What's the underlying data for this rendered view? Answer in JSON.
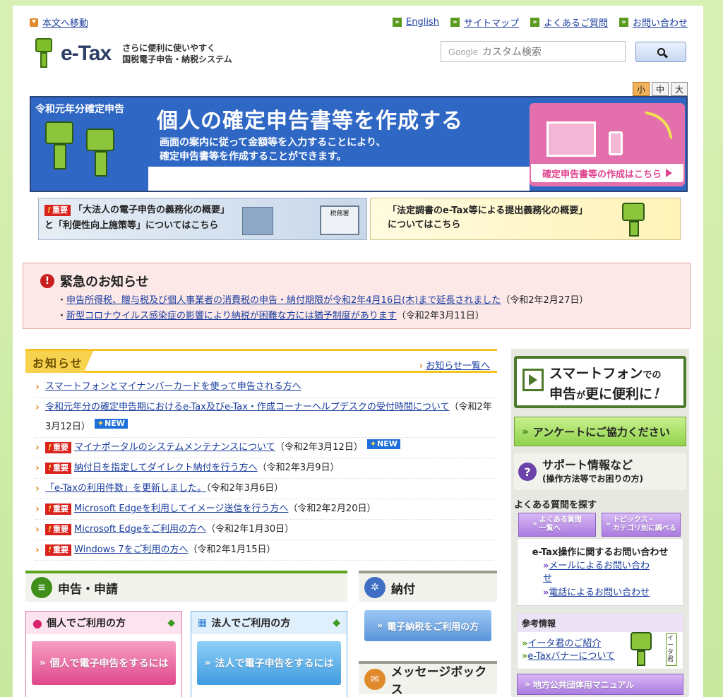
{
  "header": {
    "skip_link": "本文へ移動",
    "top_links": [
      "English",
      "サイトマップ",
      "よくあるご質問",
      "お問い合わせ"
    ],
    "logo_text": "e-Tax",
    "tagline_1": "さらに便利に使いやすく",
    "tagline_2": "国税電子申告・納税システム",
    "search_placeholder": "カスタム検索",
    "search_brand": "Google",
    "font_sizes": [
      "小",
      "中",
      "大"
    ]
  },
  "banner": {
    "year": "令和元年分確定申告",
    "title": "個人の確定申告書等を作成する",
    "sub_1": "画面の案内に従って金額等を入力することにより、",
    "sub_2": "確定申告書等を作成することができます。",
    "cta": "確定申告書等の作成はこちら"
  },
  "sub_banners": {
    "left_badge": "重要",
    "left_1": "「大法人の電子申告の義務化の概要」",
    "left_2": "と「利便性向上施策等」についてはこちら",
    "left_sign": "税務署",
    "right_1": "「法定調書のe-Tax等による提出義務化の概要」",
    "right_2": "についてはこちら"
  },
  "urgent": {
    "title": "緊急のお知らせ",
    "items": [
      {
        "link": "申告所得税、贈与税及び個人事業者の消費税の申告・納付期限が令和2年4月16日(木)まで延長されました",
        "date": "（令和2年2月27日）"
      },
      {
        "link": "新型コロナウイルス感染症の影響により納税が困難な方には猶予制度があります",
        "date": "（令和2年3月11日）"
      }
    ]
  },
  "news": {
    "title": "お知らせ",
    "all_link": "お知らせ一覧へ",
    "badge_important": "重要",
    "badge_new": "NEW",
    "items": [
      {
        "link": "スマートフォンとマイナンバーカードを使って申告される方へ",
        "date": ""
      },
      {
        "link": "令和元年分の確定申告期におけるe-Tax及びe-Tax・作成コーナーヘルプデスクの受付時間について",
        "date": "（令和2年3月12日）"
      },
      {
        "link": "マイナポータルのシステムメンテナンスについて",
        "date": "（令和2年3月12日）"
      },
      {
        "link": "納付日を指定してダイレクト納付を行う方へ",
        "date": "（令和2年3月9日）"
      },
      {
        "link": "「e-Taxの利用件数」を更新しました。",
        "date": "（令和2年3月6日）"
      },
      {
        "link": "Microsoft Edgeを利用してイメージ送信を行う方へ",
        "date": "（令和2年2月20日）"
      },
      {
        "link": "Microsoft Edgeをご利用の方へ",
        "date": "（令和2年1月30日）"
      },
      {
        "link": "Windows 7をご利用の方へ",
        "date": "（令和2年1月15日）"
      }
    ]
  },
  "services": {
    "filing_title": "申告・申請",
    "personal_head": "個人でご利用の方",
    "personal_btn": "個人で電子申告をするには",
    "corp_head": "法人でご利用の方",
    "corp_btn": "法人で電子申告をするには",
    "payment_title": "納付",
    "payment_btn": "電子納税をご利用の方",
    "message_title": "メッセージボックス"
  },
  "sidebar": {
    "smart_1": "スマートフォン",
    "smart_1b": "での",
    "smart_2": "申告",
    "smart_2b": "が",
    "smart_3": "更に便利に",
    "smart_4": "！",
    "enquete": "アンケートにご協力ください",
    "support_1": "サポート情報など",
    "support_2": "(操作方法等でお困りの方)",
    "faq_head": "よくある質問を探す",
    "faq_btn1_1": "よくある質問",
    "faq_btn1_2": "一覧へ",
    "faq_btn2_1": "トピックス・",
    "faq_btn2_2": "カテゴリ別に調べる",
    "inq_head": "e-Tax操作に関するお問い合わせ",
    "inq_mail": "メールによるお問い合わせ",
    "inq_tel": "電話によるお問い合わせ",
    "ref_head": "参考情報",
    "ref_1": "イータ君のご紹介",
    "ref_2": "e-Taxバナーについて",
    "char_tag": "イータ君",
    "manual": "地方公共団体用マニュアル"
  },
  "colors": {
    "brand_green": "#5a9a1f",
    "banner_blue": "#2f67c4",
    "cta_pink": "#e46fad",
    "urgent_bg": "#fde8e8"
  }
}
